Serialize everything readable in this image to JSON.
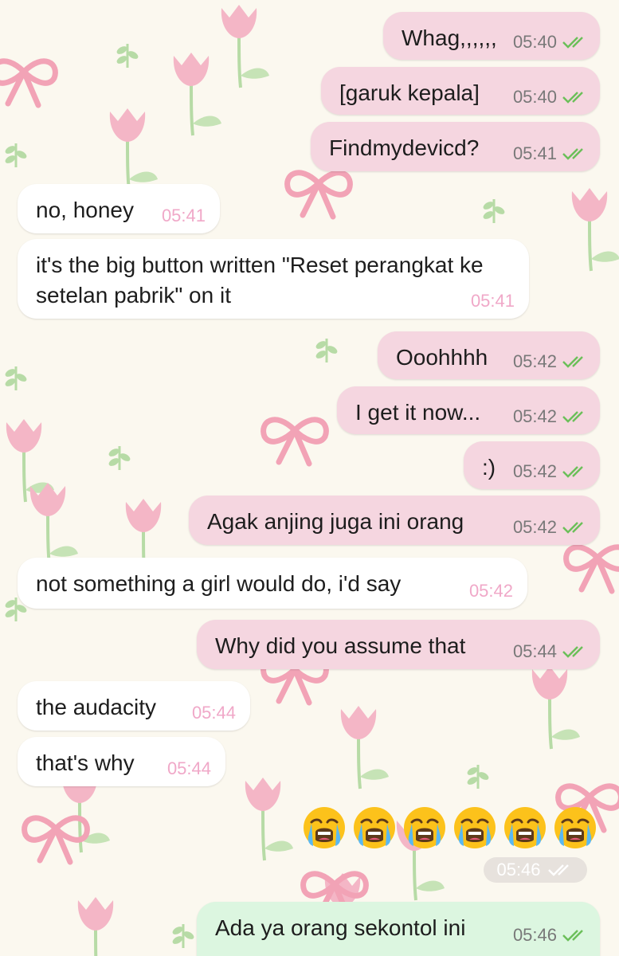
{
  "chat": {
    "messages": [
      {
        "text": "Whag,,,,,,",
        "time": "05:40",
        "direction": "out",
        "status": "read"
      },
      {
        "text": "[garuk kepala]",
        "time": "05:40",
        "direction": "out",
        "status": "read"
      },
      {
        "text": "Findmydevicd?",
        "time": "05:41",
        "direction": "out",
        "status": "read"
      },
      {
        "text": "no, honey",
        "time": "05:41",
        "direction": "in"
      },
      {
        "text": "it's the big button written \"Reset perangkat ke setelan pabrik\" on it",
        "time": "05:41",
        "direction": "in"
      },
      {
        "text": "Ooohhhh",
        "time": "05:42",
        "direction": "out",
        "status": "read"
      },
      {
        "text": "I get it now...",
        "time": "05:42",
        "direction": "out",
        "status": "read"
      },
      {
        "text": ":)",
        "time": "05:42",
        "direction": "out",
        "status": "read"
      },
      {
        "text": "Agak anjing juga ini orang",
        "time": "05:42",
        "direction": "out",
        "status": "read"
      },
      {
        "text": "not something a girl would do, i'd say",
        "time": "05:42",
        "direction": "in"
      },
      {
        "text": "Why did you assume that",
        "time": "05:44",
        "direction": "out",
        "status": "read"
      },
      {
        "text": "the audacity",
        "time": "05:44",
        "direction": "in"
      },
      {
        "text": "that's why",
        "time": "05:44",
        "direction": "in"
      },
      {
        "text": "Ada ya orang sekontol ini",
        "time": "05:46",
        "direction": "out",
        "status": "read"
      }
    ],
    "emoji_message": {
      "emojis": [
        "loudly-crying-face",
        "loudly-crying-face",
        "loudly-crying-face",
        "loudly-crying-face",
        "loudly-crying-face",
        "loudly-crying-face"
      ],
      "time": "05:46",
      "direction": "out",
      "status": "read"
    }
  },
  "colors": {
    "background": "#fbf8ef",
    "outgoing_bubble": "#f5d6e0",
    "incoming_bubble": "#ffffff",
    "last_outgoing_bubble": "#dcf6e0",
    "read_tick": "#6bbf59",
    "incoming_time": "#f0a8c8",
    "flower": "#f4b6c6",
    "leaf": "#b7dba6",
    "ribbon": "#f2a3b6"
  }
}
